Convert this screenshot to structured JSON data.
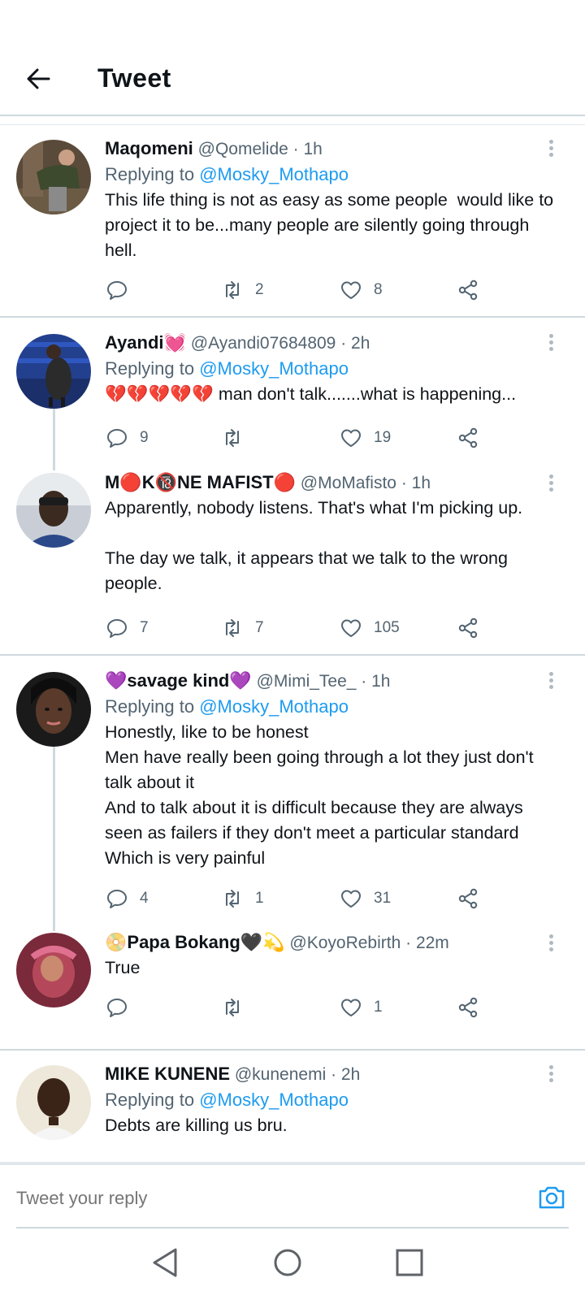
{
  "header": {
    "title": "Tweet"
  },
  "tweets": [
    {
      "name": "Maqomeni",
      "handle": "@Qomelide",
      "time": " · 1h",
      "replying_prefix": "Replying to ",
      "replying_to": "@Mosky_Mothapo",
      "text": "This life thing is not as easy as some people  would like to project it to be...many people are silently going through hell.",
      "replies": "",
      "retweets": "2",
      "likes": "8"
    },
    {
      "name": "Ayandi💓",
      "handle": "@Ayandi07684809",
      "time": " · 2h",
      "replying_prefix": "Replying to ",
      "replying_to": "@Mosky_Mothapo",
      "text": "💔💔💔💔💔 man don't talk.......what is happening...",
      "replies": "9",
      "retweets": "",
      "likes": "19"
    },
    {
      "name": "M🔴K🔞NE MAFIST🔴",
      "handle": "@MoMafisto",
      "time": " · 1h",
      "text": "Apparently, nobody listens. That's what I'm picking up.\n\nThe day we talk, it appears that we talk to the wrong people.",
      "replies": "7",
      "retweets": "7",
      "likes": "105"
    },
    {
      "name": "💜savage kind💜",
      "handle": "@Mimi_Tee_",
      "time": " · 1h",
      "replying_prefix": "Replying to ",
      "replying_to": "@Mosky_Mothapo",
      "text": "Honestly, like to be honest\nMen have really been going through a lot they just don't talk about it\nAnd to talk about it is difficult because they are always seen as failers if they don't meet a particular standard\nWhich is very painful",
      "replies": "4",
      "retweets": "1",
      "likes": "31"
    },
    {
      "name": "📀Papa Bokang🖤💫",
      "handle": "@KoyoRebirth",
      "time": " · 22m",
      "text": "True",
      "replies": "",
      "retweets": "",
      "likes": "1"
    },
    {
      "name": "MIKE KUNENE",
      "handle": "@kunenemi",
      "time": " · 2h",
      "replying_prefix": "Replying to ",
      "replying_to": "@Mosky_Mothapo",
      "text": "Debts are killing us bru."
    }
  ],
  "compose": {
    "placeholder": "Tweet your reply"
  },
  "colors": {
    "accent": "#1d9bf0",
    "muted": "#536471",
    "divider": "#cfd9de"
  }
}
